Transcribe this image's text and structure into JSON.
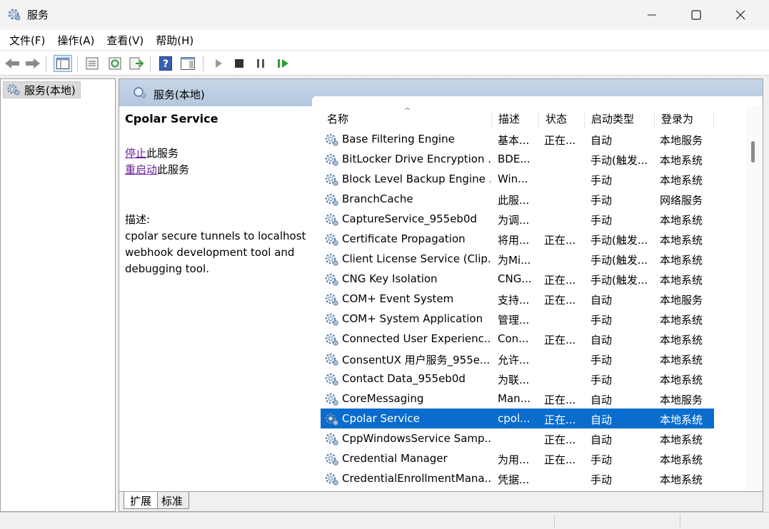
{
  "window": {
    "title": "服务",
    "icon": "gear-icon"
  },
  "menu": [
    "文件(F)",
    "操作(A)",
    "查看(V)",
    "帮助(H)"
  ],
  "toolbar": {
    "buttons": [
      "back-arrow-icon",
      "forward-arrow-icon",
      "console-tree-icon",
      "properties-icon",
      "refresh-icon",
      "export-list-icon",
      "help-icon",
      "show-hide-pane-icon",
      "play-icon",
      "stop-icon",
      "pause-icon",
      "restart-icon"
    ]
  },
  "tree": {
    "root_label": "服务(本地)"
  },
  "panel": {
    "header_title": "服务(本地)"
  },
  "details": {
    "service_name": "Cpolar Service",
    "stop_link": "停止",
    "stop_suffix": "此服务",
    "restart_link": "重启动",
    "restart_suffix": "此服务",
    "desc_label": "描述:",
    "desc_text": "cpolar secure tunnels to localhost webhook development tool and debugging tool."
  },
  "columns": {
    "name": "名称",
    "desc": "描述",
    "status": "状态",
    "startup": "启动类型",
    "logon": "登录为",
    "sort_indicator": "^"
  },
  "rows": [
    {
      "name": "Base Filtering Engine",
      "desc": "基本...",
      "status": "正在...",
      "startup": "自动",
      "logon": "本地服务"
    },
    {
      "name": "BitLocker Drive Encryption ...",
      "desc": "BDE...",
      "status": "",
      "startup": "手动(触发...",
      "logon": "本地系统"
    },
    {
      "name": "Block Level Backup Engine ...",
      "desc": "Win...",
      "status": "",
      "startup": "手动",
      "logon": "本地系统"
    },
    {
      "name": "BranchCache",
      "desc": "此服...",
      "status": "",
      "startup": "手动",
      "logon": "网络服务"
    },
    {
      "name": "CaptureService_955eb0d",
      "desc": "为调...",
      "status": "",
      "startup": "手动",
      "logon": "本地系统"
    },
    {
      "name": "Certificate Propagation",
      "desc": "将用...",
      "status": "正在...",
      "startup": "手动(触发...",
      "logon": "本地系统"
    },
    {
      "name": "Client License Service (Clip...",
      "desc": "为Mi...",
      "status": "",
      "startup": "手动(触发...",
      "logon": "本地系统"
    },
    {
      "name": "CNG Key Isolation",
      "desc": "CNG...",
      "status": "正在...",
      "startup": "手动(触发...",
      "logon": "本地系统"
    },
    {
      "name": "COM+ Event System",
      "desc": "支持...",
      "status": "正在...",
      "startup": "自动",
      "logon": "本地服务"
    },
    {
      "name": "COM+ System Application",
      "desc": "管理...",
      "status": "",
      "startup": "手动",
      "logon": "本地系统"
    },
    {
      "name": "Connected User Experienc...",
      "desc": "Con...",
      "status": "正在...",
      "startup": "自动",
      "logon": "本地系统"
    },
    {
      "name": "ConsentUX 用户服务_955e...",
      "desc": "允许...",
      "status": "",
      "startup": "手动",
      "logon": "本地系统"
    },
    {
      "name": "Contact Data_955eb0d",
      "desc": "为联...",
      "status": "",
      "startup": "手动",
      "logon": "本地系统"
    },
    {
      "name": "CoreMessaging",
      "desc": "Man...",
      "status": "正在...",
      "startup": "自动",
      "logon": "本地服务"
    },
    {
      "name": "Cpolar Service",
      "desc": "cpol...",
      "status": "正在...",
      "startup": "自动",
      "logon": "本地系统",
      "selected": true
    },
    {
      "name": "CppWindowsService Samp...",
      "desc": "",
      "status": "正在...",
      "startup": "自动",
      "logon": "本地系统"
    },
    {
      "name": "Credential Manager",
      "desc": "为用...",
      "status": "正在...",
      "startup": "手动",
      "logon": "本地系统"
    },
    {
      "name": "CredentialEnrollmentMana...",
      "desc": "凭据...",
      "status": "",
      "startup": "手动",
      "logon": "本地系统"
    }
  ],
  "tabs": [
    "扩展",
    "标准"
  ],
  "colors": {
    "selection": "#0a6dce",
    "link": "#6b1d9a",
    "header_gradient": "#b3c7de"
  }
}
